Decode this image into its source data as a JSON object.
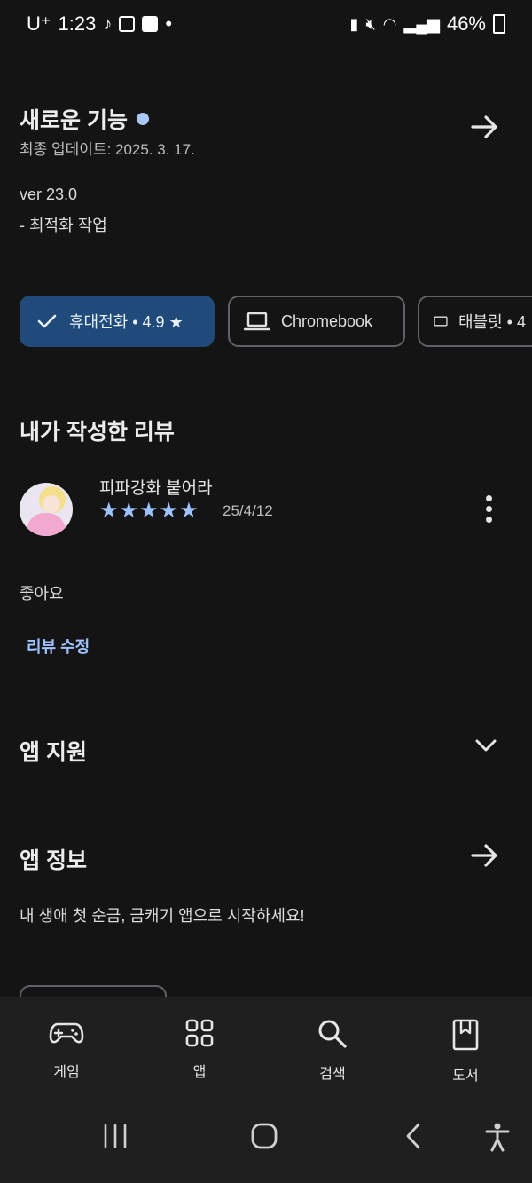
{
  "status_bar": {
    "carrier": "U⁺",
    "time": "1:23",
    "dot": "•",
    "battery": "46%"
  },
  "whats_new": {
    "title": "새로운 기능",
    "updated": "최종 업데이트: 2025. 3. 17.",
    "version": "ver 23.0",
    "note": "- 최적화 작업"
  },
  "device_chips": [
    {
      "label": "휴대전화 • 4.9 ★",
      "selected": true
    },
    {
      "label": "Chromebook",
      "selected": false
    },
    {
      "label": "태블릿 • 4",
      "selected": false
    }
  ],
  "my_review": {
    "heading": "내가 작성한 리뷰",
    "reviewer": "피파강화 붙어라",
    "stars": "★★★★★",
    "rating": 5,
    "date": "25/4/12",
    "text": "좋아요",
    "edit_label": "리뷰 수정"
  },
  "app_support": {
    "heading": "앱 지원"
  },
  "app_info": {
    "heading": "앱 정보",
    "description": "내 생애 첫 순금, 금캐기 앱으로 시작하세요!"
  },
  "bottom_nav": [
    {
      "label": "게임",
      "icon": "gamepad-icon"
    },
    {
      "label": "앱",
      "icon": "apps-grid-icon"
    },
    {
      "label": "검색",
      "icon": "search-icon"
    },
    {
      "label": "도서",
      "icon": "book-icon"
    }
  ],
  "colors": {
    "background": "#141414",
    "accent": "#9ec1ff",
    "chip_selected": "#1f4a7a",
    "nav_background": "#1f1f1f"
  }
}
